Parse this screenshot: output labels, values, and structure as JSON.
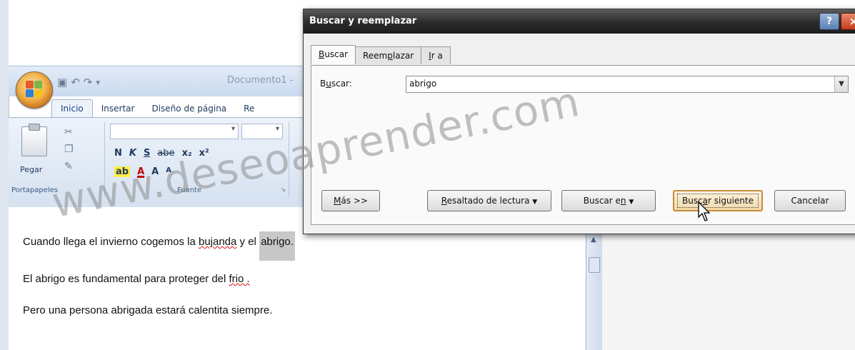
{
  "word": {
    "doc_title": "Documento1 -",
    "tabs": [
      "Inicio",
      "Insertar",
      "Diseño de página",
      "Re"
    ],
    "clipboard": {
      "paste_label": "Pegar",
      "group_label": "Portapapeles"
    },
    "font_group": {
      "group_label": "Fuente",
      "bold": "N",
      "italic": "K",
      "underline": "S",
      "strike": "abe",
      "subscript": "x₂",
      "superscript": "x²",
      "font_color": "A",
      "grow": "A",
      "shrink": "A"
    },
    "document": {
      "line1_before": "Cuando llega el invierno cogemos la ",
      "line1_typo": "bujanda",
      "line1_mid": " y el ",
      "line1_selected": "abrigo.",
      "line2_before": "El abrigo es fundamental para proteger del ",
      "line2_typo": "frio .",
      "line3": "Pero una persona abrigada estará calentita siempre."
    }
  },
  "dialog": {
    "title": "Buscar y reemplazar",
    "help": "?",
    "close": "×",
    "tabs": [
      {
        "underline": "B",
        "rest": "uscar"
      },
      {
        "pre": "Reem",
        "underline": "p",
        "rest": "lazar"
      },
      {
        "underline": "I",
        "rest": "r a"
      }
    ],
    "find_label_pre": "B",
    "find_label_ul": "u",
    "find_label_rest": "scar:",
    "find_value": "abrigo",
    "buttons": {
      "more_ul": "M",
      "more_rest": "ás >>",
      "reading_ul": "R",
      "reading_rest": "esaltado de lectura",
      "find_in_pre": "Buscar e",
      "find_in_ul": "n",
      "find_next_pre": "Busc",
      "find_next_ul": "a",
      "find_next_rest": "r siguiente",
      "cancel": "Cancelar"
    }
  },
  "watermark": "www.deseoaprender.com",
  "colors": {
    "selection": "#c8c8c8",
    "primary_button_border": "#c88c3c",
    "ribbon": "#d5e1f0",
    "dialog_title": "#2b2b2b"
  }
}
